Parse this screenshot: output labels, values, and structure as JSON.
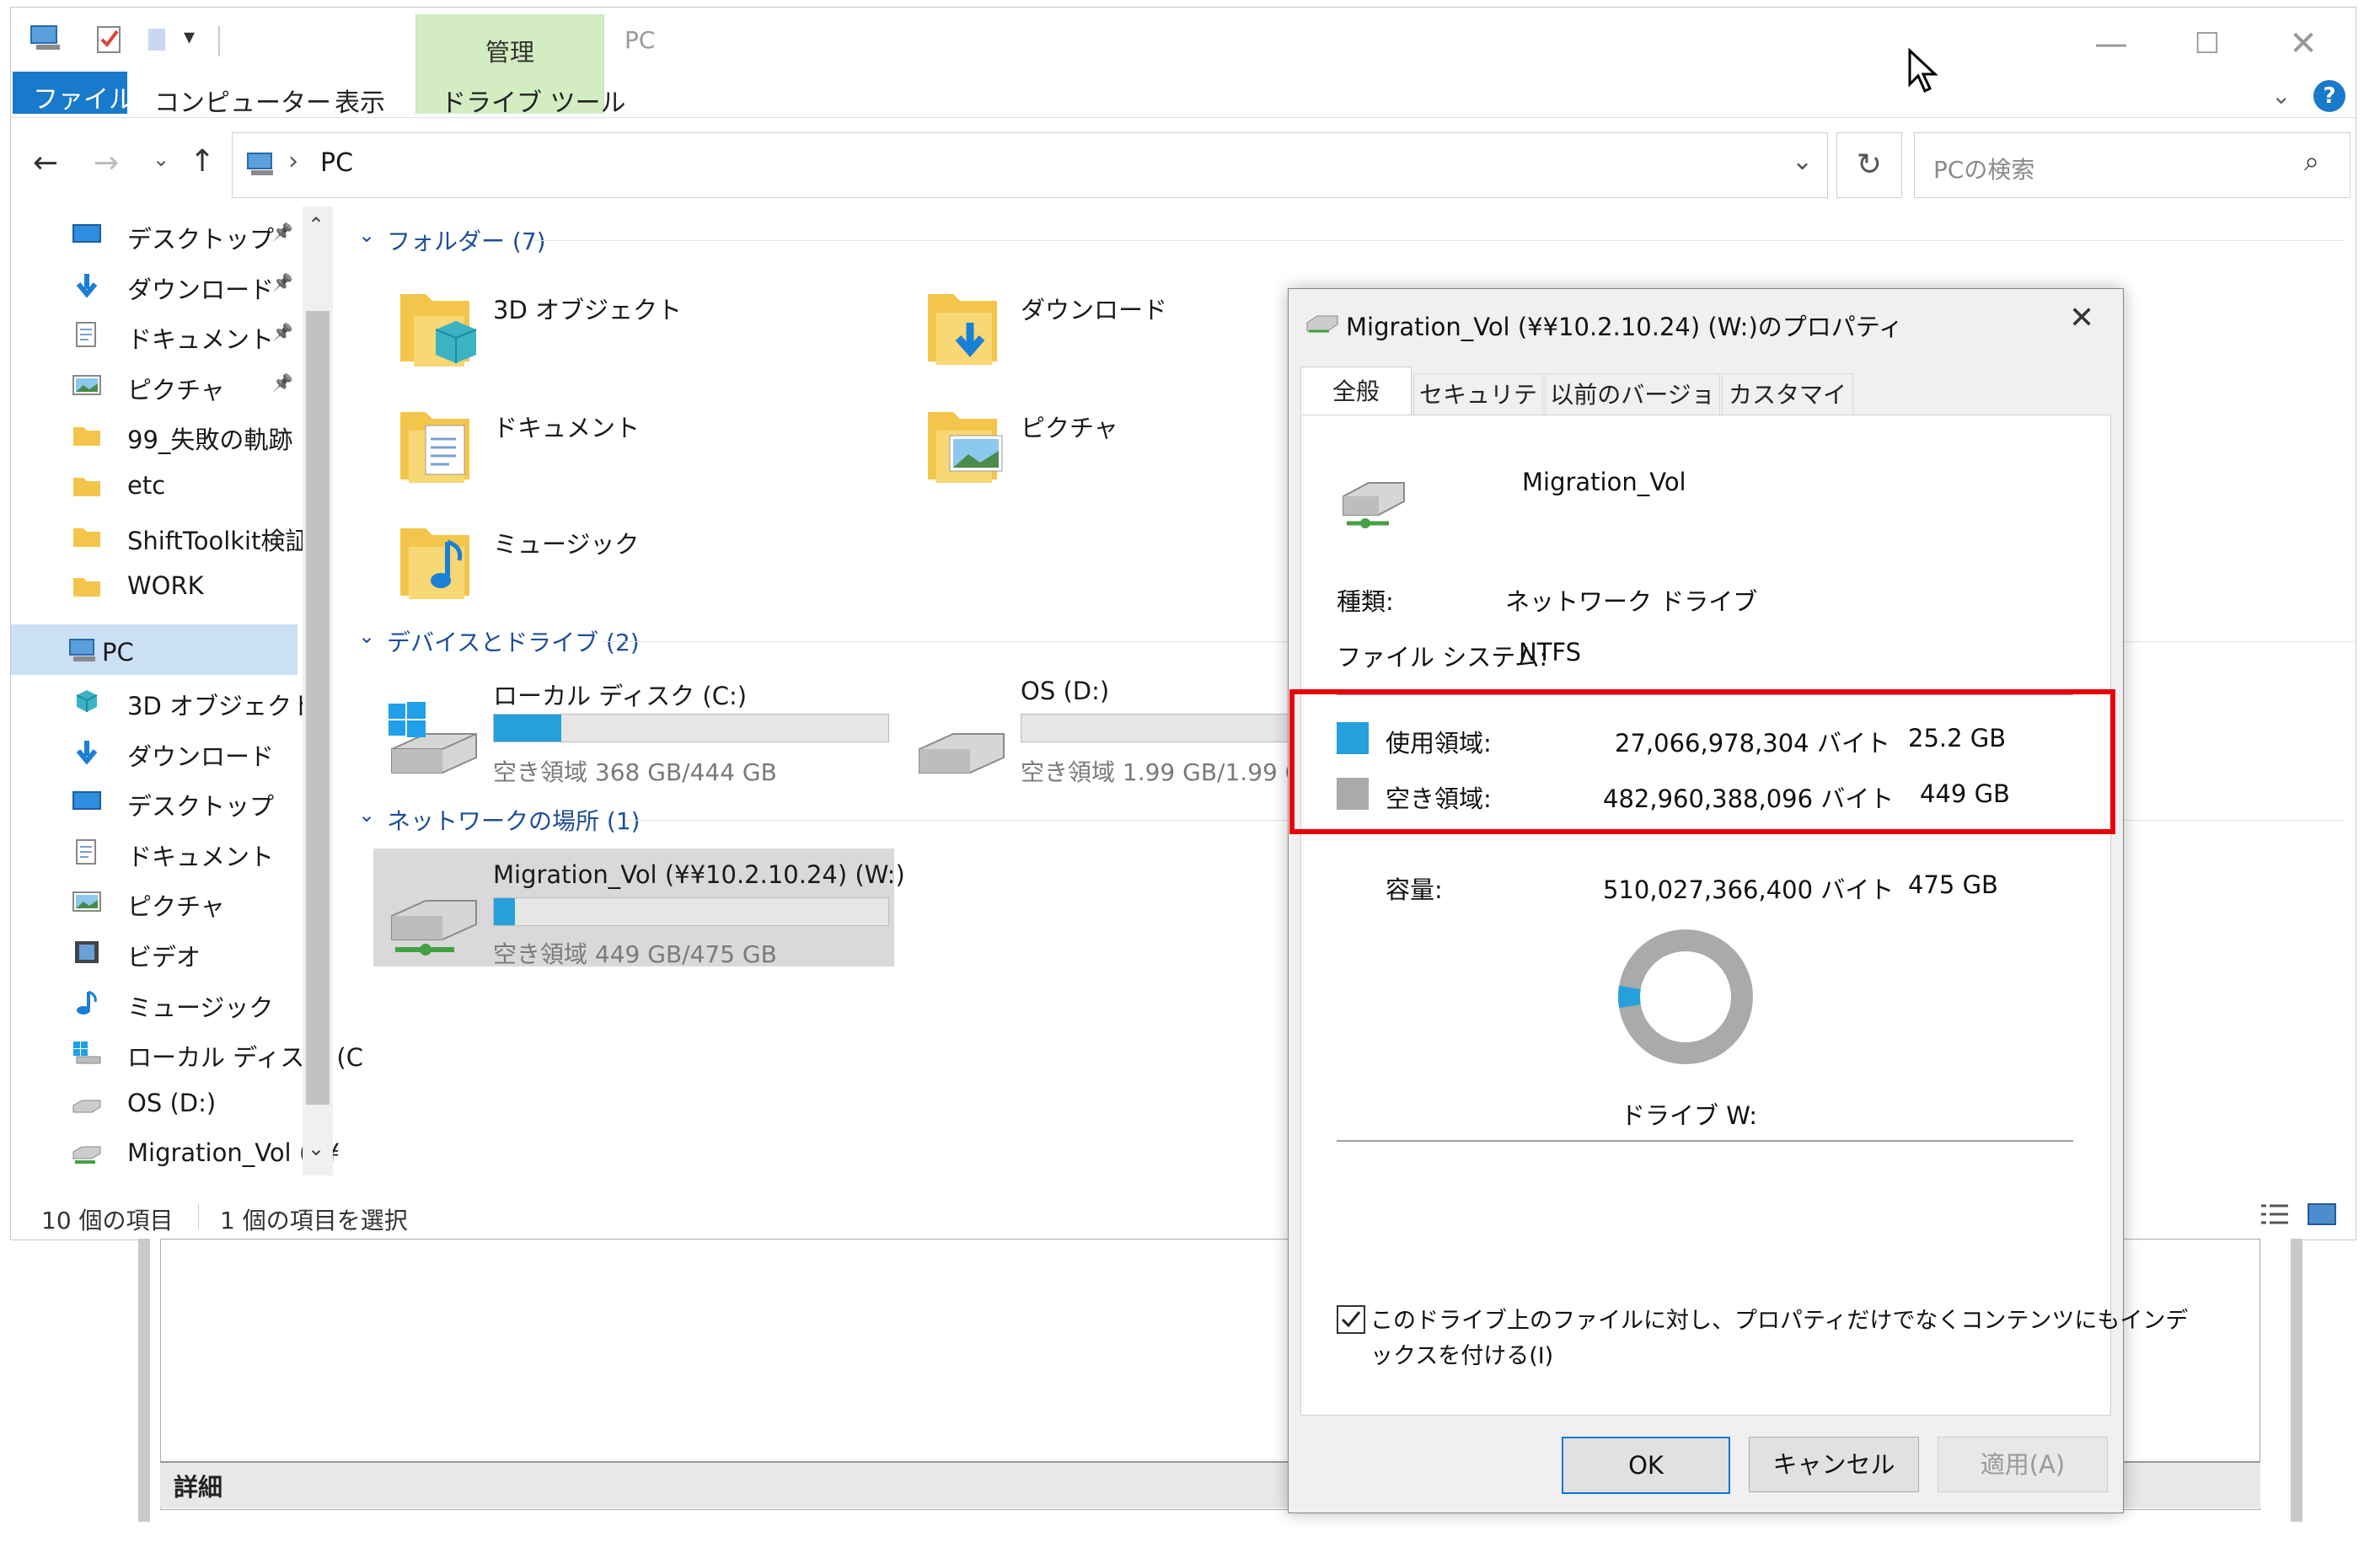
{
  "window": {
    "title": "PC",
    "qat_dropdown": "▾"
  },
  "ribbon": {
    "manage_label": "管理",
    "tabs": [
      "ファイル",
      "コンピューター",
      "表示",
      "ドライブ ツール"
    ],
    "help": "?"
  },
  "address": {
    "path": "PC",
    "search_placeholder": "PCの検索"
  },
  "sidebar": {
    "quick": [
      {
        "label": "デスクトップ",
        "icon": "desktop-icon",
        "pinned": true
      },
      {
        "label": "ダウンロード",
        "icon": "download-icon",
        "pinned": true
      },
      {
        "label": "ドキュメント",
        "icon": "document-icon",
        "pinned": true
      },
      {
        "label": "ピクチャ",
        "icon": "picture-icon",
        "pinned": true
      },
      {
        "label": "99_失敗の軌跡",
        "icon": "folder-icon"
      },
      {
        "label": "etc",
        "icon": "folder-icon"
      },
      {
        "label": "ShiftToolkit検証",
        "icon": "folder-icon"
      },
      {
        "label": "WORK",
        "icon": "folder-icon"
      }
    ],
    "pc_label": "PC",
    "pc_items": [
      {
        "label": "3D オブジェクト",
        "icon": "3d-objects-icon"
      },
      {
        "label": "ダウンロード",
        "icon": "download-icon"
      },
      {
        "label": "デスクトップ",
        "icon": "desktop-icon"
      },
      {
        "label": "ドキュメント",
        "icon": "document-icon"
      },
      {
        "label": "ピクチャ",
        "icon": "picture-icon"
      },
      {
        "label": "ビデオ",
        "icon": "video-icon"
      },
      {
        "label": "ミュージック",
        "icon": "music-icon"
      },
      {
        "label": "ローカル ディスク (C",
        "icon": "local-disk-icon"
      },
      {
        "label": "OS (D:)",
        "icon": "drive-icon"
      },
      {
        "label": "Migration_Vol (¥¥",
        "icon": "network-drive-icon"
      }
    ]
  },
  "content": {
    "folders_header": "フォルダー (7)",
    "folders": [
      "3D オブジェクト",
      "ダウンロード",
      "ドキュメント",
      "ピクチャ",
      "ミュージック"
    ],
    "devices_header": "デバイスとドライブ (2)",
    "drives": [
      {
        "name": "ローカル ディスク (C:)",
        "free": "空き領域 368 GB/444 GB",
        "used_fraction": 0.17
      },
      {
        "name": "OS (D:)",
        "free": "空き領域 1.99 GB/1.99 G",
        "used_fraction": 0.0
      }
    ],
    "network_header": "ネットワークの場所 (1)",
    "network_drive": {
      "name": "Migration_Vol (¥¥10.2.10.24) (W:)",
      "free": "空き領域 449 GB/475 GB",
      "used_fraction": 0.053
    }
  },
  "status": {
    "count": "10 個の項目",
    "selected": "1 個の項目を選択"
  },
  "details_label": "詳細",
  "dialog": {
    "title": "Migration_Vol (¥¥10.2.10.24) (W:)のプロパティ",
    "tabs": [
      "全般",
      "セキュリティ",
      "以前のバージョン",
      "カスタマイズ"
    ],
    "drive_name": "Migration_Vol",
    "type_label": "種類:",
    "type_value": "ネットワーク ドライブ",
    "fs_label": "ファイル システム:",
    "fs_value": "NTFS",
    "used_label": "使用領域:",
    "used_bytes": "27,066,978,304 バイト",
    "used_gb": "25.2 GB",
    "free_label": "空き領域:",
    "free_bytes": "482,960,388,096 バイト",
    "free_gb": "449 GB",
    "capacity_label": "容量:",
    "capacity_bytes": "510,027,366,400 バイト",
    "capacity_gb": "475 GB",
    "drive_label": "ドライブ W:",
    "index_checkbox": "このドライブ上のファイルに対し、プロパティだけでなくコンテンツにもインデ",
    "index_checkbox_line2": "ックスを付ける(I)",
    "index_checked": true,
    "used_fraction": 0.053,
    "ok": "OK",
    "cancel": "キャンセル",
    "apply": "適用(A)"
  },
  "colors": {
    "used": "#26a0da",
    "free": "#aaaaaa",
    "highlight": "#e8000b",
    "file_tab": "#1979ca",
    "manage_tab": "#d4ecc2"
  }
}
